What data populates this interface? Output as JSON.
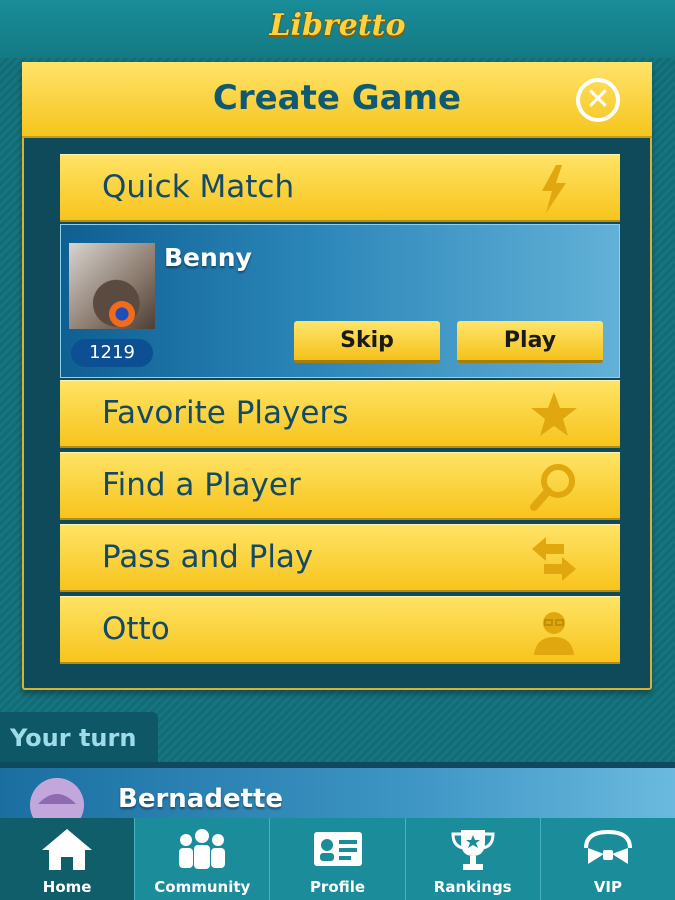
{
  "app": {
    "logo_text": "Libretto"
  },
  "dialog": {
    "title": "Create Game",
    "menu_items": [
      {
        "label": "Quick Match",
        "icon": "lightning-icon"
      },
      {
        "label": "Favorite Players",
        "icon": "star-icon"
      },
      {
        "label": "Find a Player",
        "icon": "magnifier-icon"
      },
      {
        "label": "Pass and Play",
        "icon": "swap-arrows-icon"
      },
      {
        "label": "Otto",
        "icon": "bot-face-icon"
      }
    ],
    "quick_match": {
      "player_name": "Benny",
      "rating": "1219",
      "skip_label": "Skip",
      "play_label": "Play"
    }
  },
  "section": {
    "your_turn_label": "Your turn"
  },
  "games": [
    {
      "player_name": "Bernadette"
    }
  ],
  "nav": {
    "items": [
      {
        "label": "Home",
        "icon": "home-icon",
        "active": true
      },
      {
        "label": "Community",
        "icon": "people-icon",
        "active": false
      },
      {
        "label": "Profile",
        "icon": "id-card-icon",
        "active": false
      },
      {
        "label": "Rankings",
        "icon": "trophy-icon",
        "active": false
      },
      {
        "label": "VIP",
        "icon": "bowtie-icon",
        "active": false
      }
    ]
  },
  "colors": {
    "accent_yellow": "#f7c41d",
    "title_blue": "#0f5a72",
    "panel_teal": "#0e4a59",
    "nav_teal": "#1b8c99"
  }
}
